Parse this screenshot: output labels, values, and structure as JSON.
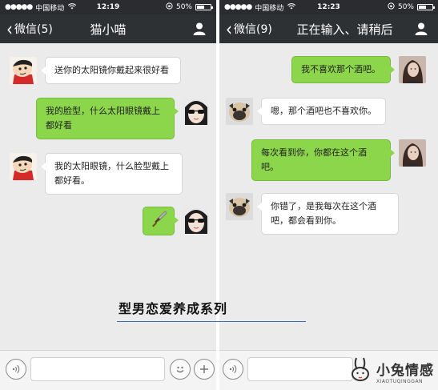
{
  "left_phone": {
    "status": {
      "signal": "●●●●●",
      "carrier": "中国移动",
      "time": "12:19",
      "battery": "50%"
    },
    "nav": {
      "back_label": "微信(5)",
      "title": "猫小喵"
    },
    "messages": [
      {
        "side": "left",
        "avatar": "crayon-shinchan-avatar",
        "text": "送你的太阳镜你戴起来很好看"
      },
      {
        "side": "right",
        "avatar": "girl-sunglasses-avatar",
        "text": "我的脸型，什么太阳眼镜戴上都好看"
      },
      {
        "side": "left",
        "avatar": "crayon-shinchan-avatar",
        "text": "我的太阳眼镜，什么脸型戴上都好看。"
      },
      {
        "side": "right",
        "avatar": "girl-sunglasses-avatar",
        "icon": "knife-emoji-icon"
      }
    ]
  },
  "right_phone": {
    "status": {
      "signal": "●●●●●",
      "carrier": "中国移动",
      "time": "12:23",
      "battery": "50%"
    },
    "nav": {
      "back_label": "微信(9)",
      "title": "正在输入、请稍后"
    },
    "messages": [
      {
        "side": "right",
        "avatar": "woman-portrait-avatar",
        "text": "我不喜欢那个酒吧。"
      },
      {
        "side": "left",
        "avatar": "pug-dog-avatar",
        "text": "嗯，那个酒吧也不喜欢你。"
      },
      {
        "side": "right",
        "avatar": "woman-portrait-avatar",
        "text": "每次看到你，你都在这个酒吧。"
      },
      {
        "side": "left",
        "avatar": "pug-dog-avatar",
        "text": "你错了，是我每次在这个酒吧，都会看到你。"
      }
    ]
  },
  "caption": "型男恋爱养成系列",
  "watermark": {
    "main": "小兔情感",
    "sub": "XIAOTUQINGGAN"
  },
  "colors": {
    "green_bubble": "#8cd64b",
    "nav_bg": "#2e3134",
    "chat_bg": "#ebebeb"
  }
}
